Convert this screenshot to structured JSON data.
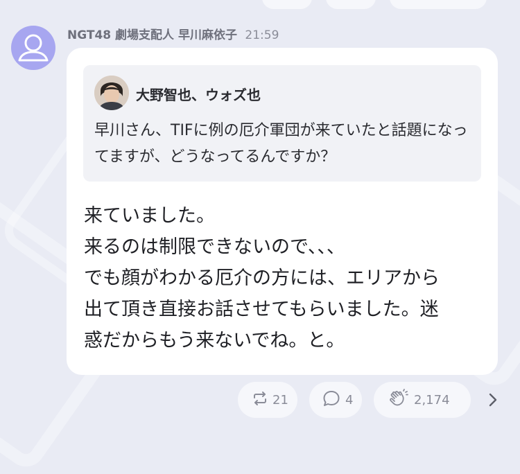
{
  "post": {
    "author": "NGT48 劇場支配人 早川麻依子",
    "time": "21:59",
    "quote": {
      "author": "大野智也、ウォズ也",
      "text": "早川さん、TIFに例の厄介軍団が来ていたと話題になってますが、どうなってるんですか？"
    },
    "body_lines": [
      "来ていました。",
      "来るのは制限できないので、、、",
      "でも顔がわかる厄介の方には、エリアから",
      "出て頂き直接お話させてもらいました。迷",
      "惑だからもう来ないでね。と。"
    ]
  },
  "actions": {
    "repost_count": "21",
    "reply_count": "4",
    "clap_count": "2,174"
  },
  "icons": {
    "avatar": "default-user-icon",
    "repost": "repost-icon",
    "reply": "reply-bubble-icon",
    "clap": "clap-icon",
    "next": "chevron-right-icon"
  },
  "colors": {
    "background": "#e9ebf4",
    "card": "#ffffff",
    "avatar": "#a7a6f0",
    "quote_bg": "#f1f2f6",
    "muted_text": "#8a8c98"
  }
}
